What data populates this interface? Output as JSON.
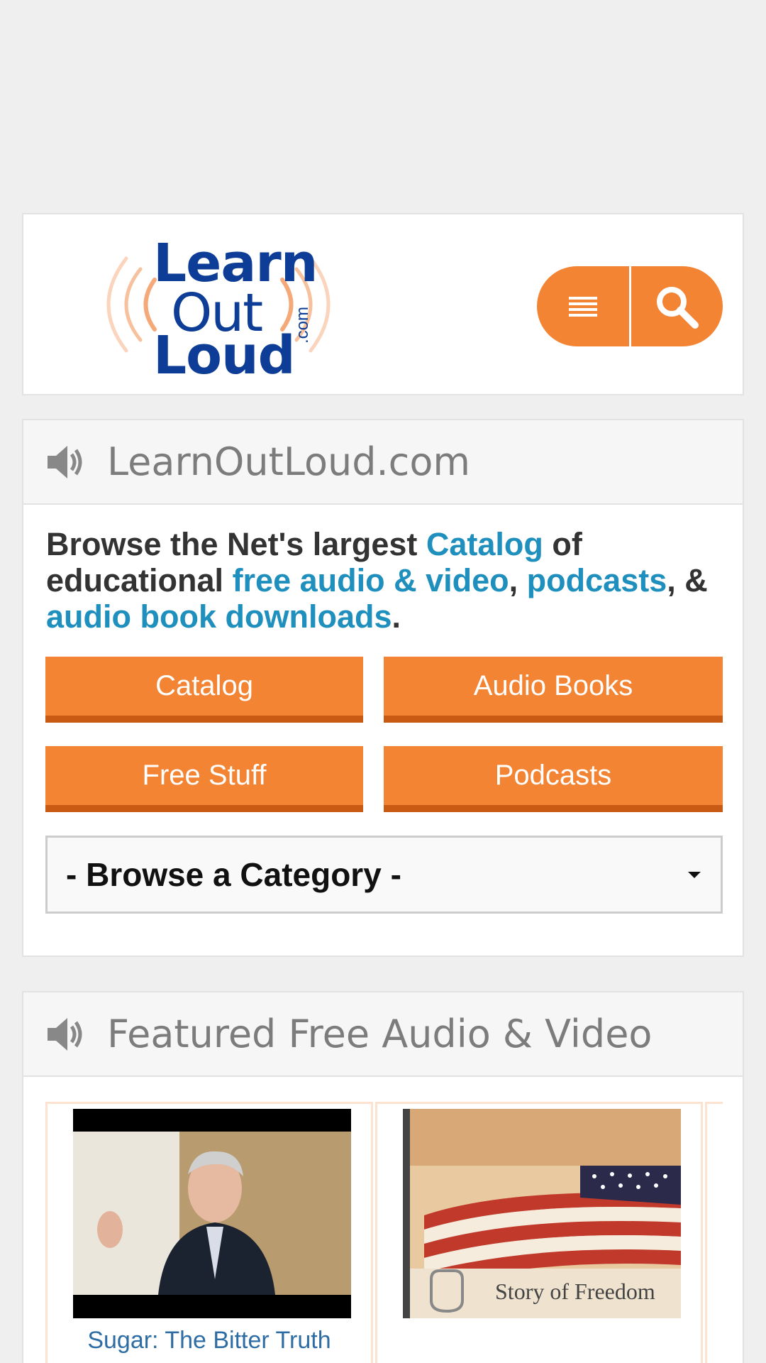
{
  "site": {
    "logo": {
      "line1": "Learn",
      "line2": "Out",
      "line3": "Loud",
      "suffix": ".com"
    },
    "icons": {
      "menu": "menu-icon",
      "search": "search-icon",
      "speaker": "speaker-icon"
    }
  },
  "intro": {
    "heading": "LearnOutLoud.com",
    "text": {
      "p1": "Browse the Net's largest ",
      "link1": "Catalog",
      "p2": " of educational ",
      "link2": "free audio & video",
      "p3": ", ",
      "link3": "podcasts",
      "p4": ", & ",
      "link4": "audio book downloads",
      "p5": "."
    },
    "buttons": {
      "catalog": "Catalog",
      "audio_books": "Audio Books",
      "free_stuff": "Free Stuff",
      "podcasts": "Podcasts"
    },
    "category_select": {
      "selected": "- Browse a Category -"
    }
  },
  "featured": {
    "heading": "Featured Free Audio & Video",
    "items": [
      {
        "caption": "Sugar: The Bitter Truth"
      },
      {
        "cover_text": "Story of Freedom"
      }
    ]
  },
  "colors": {
    "accent": "#f38433",
    "accent_dark": "#c95a14",
    "link": "#1f8fbd",
    "logo_blue": "#0d3d96"
  }
}
